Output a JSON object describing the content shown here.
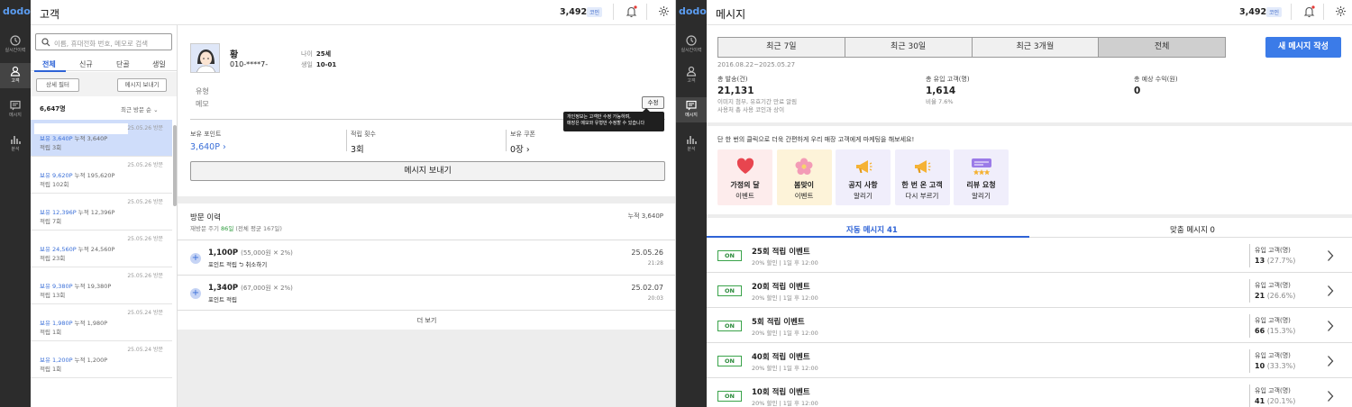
{
  "app": {
    "logo": "dodo",
    "coins": "3,492",
    "coin_badge": "코인"
  },
  "nav": {
    "items": [
      {
        "label": "실시간이력"
      },
      {
        "label": "고객"
      },
      {
        "label": "메시지"
      },
      {
        "label": "분석"
      }
    ]
  },
  "customers_screen": {
    "title": "고객",
    "search_placeholder": "이름, 휴대전화 번호, 메모로 검색",
    "tabs": [
      "전체",
      "신규",
      "단골",
      "생일"
    ],
    "filter_button": "상세 필터",
    "send_button": "메시지 보내기",
    "count": "6,647명",
    "sort_label": "최근 방문 순",
    "list": [
      {
        "date": "25.05.26 방문",
        "held": "보유 3,640P",
        "accum": "누적 3,640P",
        "visits": "적립 3회",
        "selected": true
      },
      {
        "date": "25.05.26 방문",
        "held": "보유 9,620P",
        "accum": "누적 195,620P",
        "visits": "적립 102회"
      },
      {
        "date": "25.05.26 방문",
        "held": "보유 12,396P",
        "accum": "누적 12,396P",
        "visits": "적립 7회"
      },
      {
        "date": "25.05.26 방문",
        "held": "보유 24,560P",
        "accum": "누적 24,560P",
        "visits": "적립 23회"
      },
      {
        "date": "25.05.26 방문",
        "held": "보유 9,380P",
        "accum": "누적 19,380P",
        "visits": "적립 13회"
      },
      {
        "date": "25.05.24 방문",
        "held": "보유 1,980P",
        "accum": "누적 1,980P",
        "visits": "적립 1회"
      },
      {
        "date": "25.05.24 방문",
        "held": "보유 1,200P",
        "accum": "누적 1,200P",
        "visits": "적립 1회"
      }
    ],
    "detail": {
      "name": "황",
      "phone": "010-****7-",
      "age_label": "나이",
      "age": "25세",
      "birthday_label": "생일",
      "birthday": "10-01",
      "type_label": "유형",
      "memo_label": "메모",
      "edit_button": "수정",
      "tooltip_line1": "개인정보는 고객만 수정 가능하며,",
      "tooltip_line2": "매장은 메모와 유형만 수정할 수 있습니다",
      "points_label": "보유 포인트",
      "points": "3,640P",
      "earn_count_label": "적립 횟수",
      "earn_count": "3회",
      "coupon_label": "보유 쿠폰",
      "coupon": "0장",
      "send_message_button": "메시지 보내기",
      "visit_history_title": "방문 이력",
      "visit_cycle_prefix": "재방문 주기",
      "visit_cycle_value": "86일",
      "visit_cycle_suffix": "(전체 평균 167일)",
      "visit_total": "누적 3,640P",
      "visits": [
        {
          "amount": "1,100P",
          "detail": "(55,000원 ✕ 2%)",
          "type": "포인트 적립",
          "cancel": "⮌ 취소하기",
          "date": "25.05.26",
          "time": "21:28"
        },
        {
          "amount": "1,340P",
          "detail": "(67,000원 ✕ 2%)",
          "type": "포인트 적립",
          "cancel": "",
          "date": "25.02.07",
          "time": "20:03"
        }
      ],
      "more_button": "더 보기"
    }
  },
  "messages_screen": {
    "title": "메시지",
    "periods": [
      "최근 7일",
      "최근 30일",
      "최근 3개월",
      "전체"
    ],
    "selected_period": "전체",
    "new_button": "새 메시지 작성",
    "date_range": "2016.08.22~2025.05.27",
    "stats": {
      "sent_label": "총 발송(건)",
      "sent": "21,131",
      "sent_note1": "이미지 첨부, 유효기간 만료 알림",
      "sent_note2": "사용처 총 사용 코인과 상이",
      "inflow_label": "총 유입 고객(명)",
      "inflow": "1,614",
      "inflow_note": "비율 7.6%",
      "revenue_label": "총 예상 수익(원)",
      "revenue": "0"
    },
    "promo_text": "단 한 번의 클릭으로 더욱 간편하게 우리 매장 고객에게 마케팅을 해보세요!",
    "promo_tiles": [
      {
        "line1": "가정의 달",
        "line2": "이벤트",
        "icon": "heart-icon",
        "bg": "#fdecec"
      },
      {
        "line1": "봄맞이",
        "line2": "이벤트",
        "icon": "flower-icon",
        "bg": "#fdf3d9"
      },
      {
        "line1": "공지 사항",
        "line2": "알리기",
        "icon": "megaphone-icon",
        "bg": "#f0eefb"
      },
      {
        "line1": "한 번 온 고객",
        "line2": "다시 부르기",
        "icon": "megaphone-icon",
        "bg": "#f0eefb"
      },
      {
        "line1": "리뷰 요청",
        "line2": "알리기",
        "icon": "review-icon",
        "bg": "#f0eefb"
      }
    ],
    "tabs": [
      "자동 메시지 41",
      "맞춤 메시지 0"
    ],
    "auto_messages": [
      {
        "status": "ON",
        "name": "25회 적립 이벤트",
        "desc": "20% 할인 | 1일 후 12:00",
        "inflow_label": "유입 고객(명)",
        "count": "13",
        "ratio": "(27.7%)"
      },
      {
        "status": "ON",
        "name": "20회 적립 이벤트",
        "desc": "20% 할인 | 1일 후 12:00",
        "inflow_label": "유입 고객(명)",
        "count": "21",
        "ratio": "(26.6%)"
      },
      {
        "status": "ON",
        "name": "5회 적립 이벤트",
        "desc": "20% 할인 | 1일 후 12:00",
        "inflow_label": "유입 고객(명)",
        "count": "66",
        "ratio": "(15.3%)"
      },
      {
        "status": "ON",
        "name": "40회 적립 이벤트",
        "desc": "20% 할인 | 1일 후 12:00",
        "inflow_label": "유입 고객(명)",
        "count": "10",
        "ratio": "(33.3%)"
      },
      {
        "status": "ON",
        "name": "10회 적립 이벤트",
        "desc": "20% 할인 | 1일 후 12:00",
        "inflow_label": "유입 고객(명)",
        "count": "41",
        "ratio": "(20.1%)"
      }
    ]
  },
  "colors": {
    "accent": "#3b7be8",
    "selected_row": "#cfddfa",
    "on_green": "#2a8a3a",
    "rail": "#2c2c2c"
  }
}
